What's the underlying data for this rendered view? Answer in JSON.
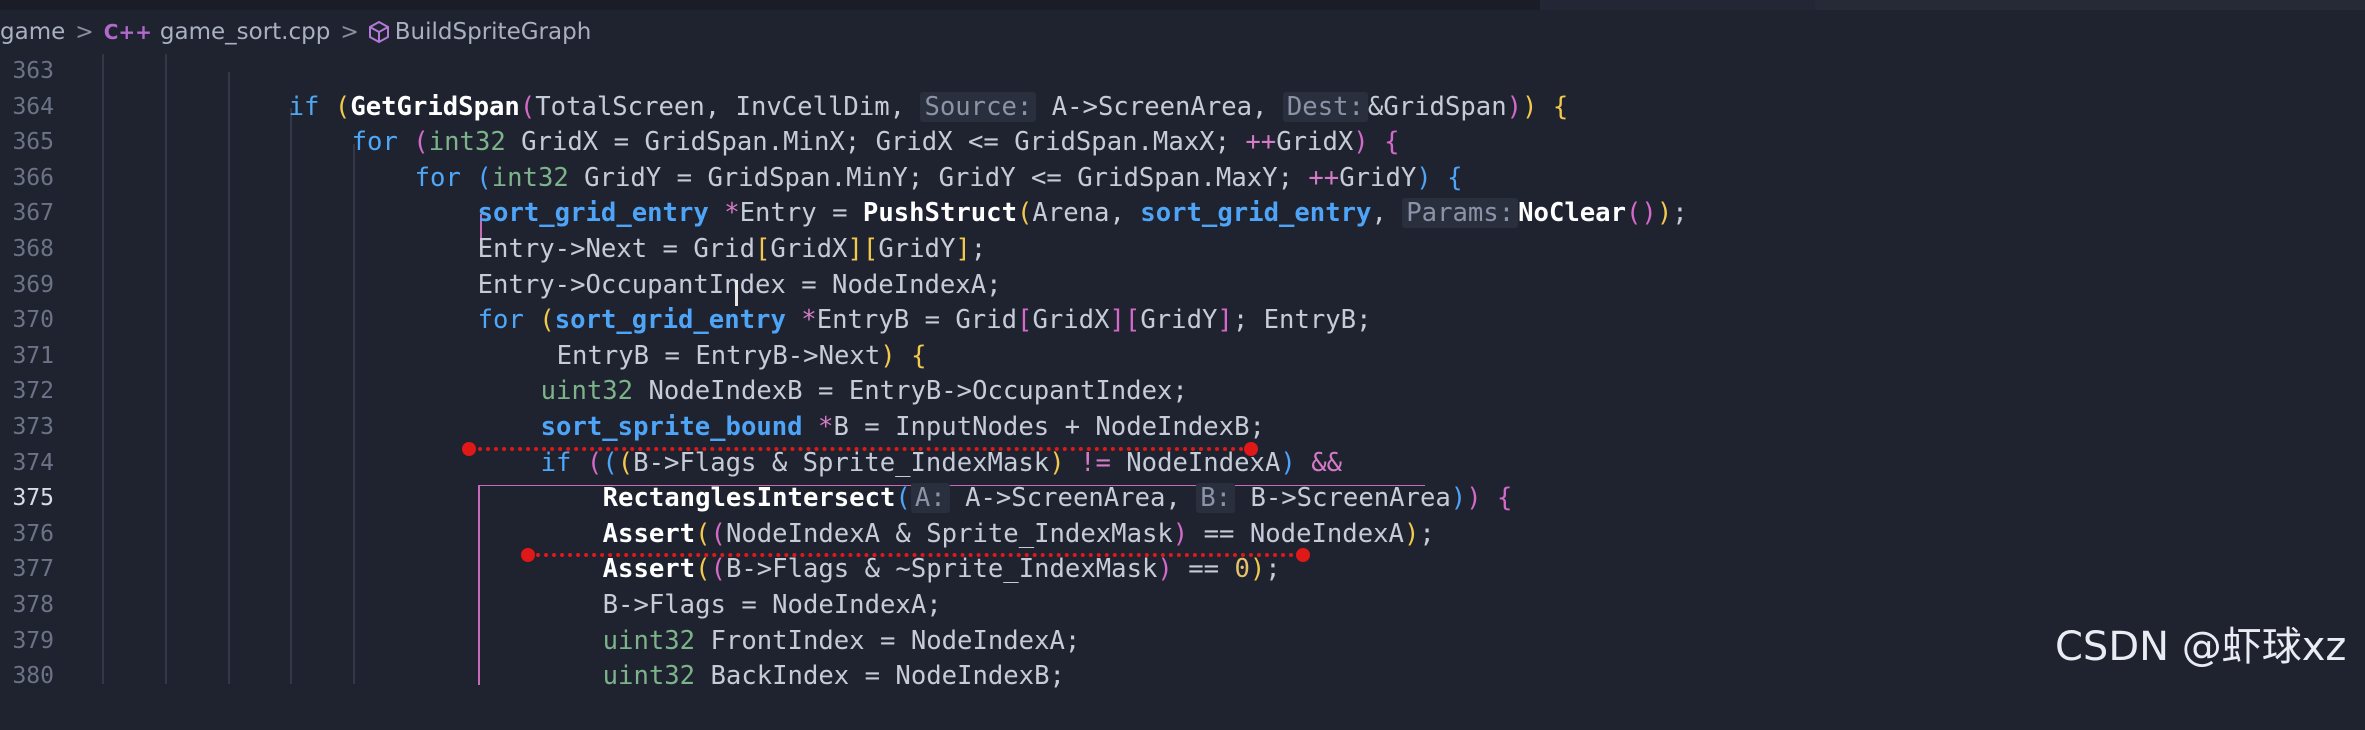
{
  "breadcrumb": {
    "folder": "game",
    "file": "game_sort.cpp",
    "file_icon": "cpp-file-icon",
    "symbol": "BuildSpriteGraph",
    "symbol_icon": "method-cube-icon",
    "separator": ">"
  },
  "editor": {
    "active_line": "375",
    "lines": [
      {
        "number": "363"
      },
      {
        "number": "364"
      },
      {
        "number": "365"
      },
      {
        "number": "366"
      },
      {
        "number": "367"
      },
      {
        "number": "368"
      },
      {
        "number": "369"
      },
      {
        "number": "370"
      },
      {
        "number": "371"
      },
      {
        "number": "372"
      },
      {
        "number": "373"
      },
      {
        "number": "374"
      },
      {
        "number": "375"
      },
      {
        "number": "376"
      },
      {
        "number": "377"
      },
      {
        "number": "378"
      },
      {
        "number": "379"
      },
      {
        "number": "380"
      }
    ],
    "tokens": {
      "if": "if",
      "for": "for",
      "int32": "int32",
      "uint32": "uint32",
      "GetGridSpan": "GetGridSpan",
      "TotalScreen": "TotalScreen, InvCellDim, ",
      "hint_source": "Source:",
      "AScreen": " A->ScreenArea, ",
      "hint_dest": "Dest:",
      "GridSpanArg": "&GridSpan",
      "GridX_decl": " GridX = GridSpan.MinX; GridX <= GridSpan.MaxX; ",
      "inc": "++",
      "GridX": "GridX",
      "GridY_decl": " GridY = GridSpan.MinY; GridY <= GridSpan.MaxY; ",
      "GridY": "GridY",
      "sort_grid_entry": "sort_grid_entry",
      "star": "*",
      "Entry_eq": "Entry = ",
      "PushStruct": "PushStruct",
      "Arena": "Arena, ",
      "hint_params": "Params:",
      "NoClear": "NoClear",
      "l367": "Entry->Next = Grid",
      "l368": "Entry->OccupantIndex = NodeIndexA;",
      "EntryB_eq": "EntryB = Grid",
      "EntryB_cond": "; EntryB;",
      "l370": "EntryB = EntryB->Next",
      "l371": " NodeIndexB = EntryB->OccupantIndex;",
      "sort_sprite_bound": "sort_sprite_bound",
      "l372": "B = InputNodes + NodeIndexB;",
      "l373a": "B->Flags & Sprite_IndexMask",
      "neq": " != ",
      "l373b": "NodeIndexA",
      "andand": " &&",
      "RectanglesIntersect": "RectanglesIntersect",
      "hint_a": "A:",
      "l374a": " A->ScreenArea, ",
      "hint_b": "B:",
      "l374b": " B->ScreenArea",
      "Assert": "Assert",
      "l375a": "NodeIndexA & Sprite_IndexMask",
      "eqeq": " == ",
      "l375b": "NodeIndexA",
      "l376a": "B->Flags & ~Sprite_IndexMask",
      "zero": "0",
      "l377": "B->Flags = NodeIndexA;",
      "l378": " FrontIndex = NodeIndexA;",
      "l379": " BackIndex = NodeIndexB;"
    }
  },
  "watermark": "CSDN @虾球xz",
  "colors": {
    "background": "#1f2330",
    "keyword": "#4fa8f7",
    "type": "#7cb38a",
    "annotation_red": "#e01818"
  }
}
